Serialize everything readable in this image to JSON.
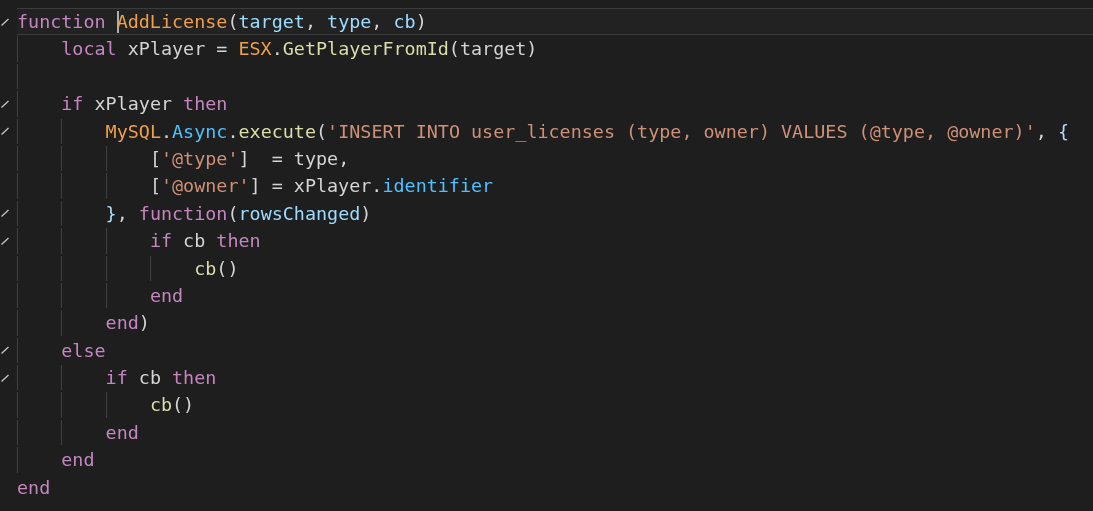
{
  "editor": {
    "lines": [
      {
        "foldable": true,
        "current": true,
        "tokens": [
          {
            "kind": "keyword",
            "text": "function "
          },
          {
            "kind": "funcdef",
            "text": "AddLicense",
            "cursor": true
          },
          {
            "kind": "plain",
            "text": "("
          },
          {
            "kind": "param",
            "text": "target"
          },
          {
            "kind": "plain",
            "text": ", "
          },
          {
            "kind": "param",
            "text": "type"
          },
          {
            "kind": "plain",
            "text": ", "
          },
          {
            "kind": "param",
            "text": "cb"
          },
          {
            "kind": "plain",
            "text": ")"
          }
        ]
      },
      {
        "foldable": false,
        "current": false,
        "tokens": [
          {
            "kind": "keyword",
            "text": "    local "
          },
          {
            "kind": "plain",
            "text": "xPlayer = "
          },
          {
            "kind": "global",
            "text": "ESX"
          },
          {
            "kind": "plain",
            "text": "."
          },
          {
            "kind": "call",
            "text": "GetPlayerFromId"
          },
          {
            "kind": "plain",
            "text": "(target)"
          }
        ]
      },
      {
        "foldable": false,
        "current": false
      },
      {
        "foldable": true,
        "current": false,
        "tokens": [
          {
            "kind": "keyword",
            "text": "    if "
          },
          {
            "kind": "plain",
            "text": "xPlayer "
          },
          {
            "kind": "keyword",
            "text": "then"
          }
        ]
      },
      {
        "foldable": true,
        "current": false,
        "tokens": [
          {
            "kind": "global",
            "text": "        MySQL"
          },
          {
            "kind": "plain",
            "text": "."
          },
          {
            "kind": "field",
            "text": "Async"
          },
          {
            "kind": "plain",
            "text": "."
          },
          {
            "kind": "call",
            "text": "execute"
          },
          {
            "kind": "plain",
            "text": "("
          },
          {
            "kind": "string",
            "text": "'INSERT INTO user_licenses (type, owner) VALUES (@type, @owner)'"
          },
          {
            "kind": "plain",
            "text": ", "
          },
          {
            "kind": "brace",
            "text": "{"
          }
        ]
      },
      {
        "foldable": false,
        "current": false,
        "tokens": [
          {
            "kind": "plain",
            "text": "            ["
          },
          {
            "kind": "string",
            "text": "'@type'"
          },
          {
            "kind": "plain",
            "text": "]  = type,"
          }
        ]
      },
      {
        "foldable": false,
        "current": false,
        "tokens": [
          {
            "kind": "plain",
            "text": "            ["
          },
          {
            "kind": "string",
            "text": "'@owner'"
          },
          {
            "kind": "plain",
            "text": "] = xPlayer."
          },
          {
            "kind": "field",
            "text": "identifier"
          }
        ]
      },
      {
        "foldable": true,
        "current": false,
        "tokens": [
          {
            "kind": "brace",
            "text": "        }"
          },
          {
            "kind": "plain",
            "text": ", "
          },
          {
            "kind": "keyword",
            "text": "function"
          },
          {
            "kind": "plain",
            "text": "("
          },
          {
            "kind": "param",
            "text": "rowsChanged"
          },
          {
            "kind": "plain",
            "text": ")"
          }
        ]
      },
      {
        "foldable": true,
        "current": false,
        "tokens": [
          {
            "kind": "keyword",
            "text": "            if "
          },
          {
            "kind": "plain",
            "text": "cb "
          },
          {
            "kind": "keyword",
            "text": "then"
          }
        ]
      },
      {
        "foldable": false,
        "current": false,
        "tokens": [
          {
            "kind": "call",
            "text": "                cb"
          },
          {
            "kind": "plain",
            "text": "()"
          }
        ]
      },
      {
        "foldable": false,
        "current": false,
        "tokens": [
          {
            "kind": "keyword",
            "text": "            end"
          }
        ]
      },
      {
        "foldable": false,
        "current": false,
        "tokens": [
          {
            "kind": "keyword",
            "text": "        end"
          },
          {
            "kind": "plain",
            "text": ")"
          }
        ]
      },
      {
        "foldable": true,
        "current": false,
        "tokens": [
          {
            "kind": "keyword",
            "text": "    else"
          }
        ]
      },
      {
        "foldable": true,
        "current": false,
        "tokens": [
          {
            "kind": "keyword",
            "text": "        if "
          },
          {
            "kind": "plain",
            "text": "cb "
          },
          {
            "kind": "keyword",
            "text": "then"
          }
        ]
      },
      {
        "foldable": false,
        "current": false,
        "tokens": [
          {
            "kind": "call",
            "text": "            cb"
          },
          {
            "kind": "plain",
            "text": "()"
          }
        ]
      },
      {
        "foldable": false,
        "current": false,
        "tokens": [
          {
            "kind": "keyword",
            "text": "        end"
          }
        ]
      },
      {
        "foldable": false,
        "current": false,
        "tokens": [
          {
            "kind": "keyword",
            "text": "    end"
          }
        ]
      },
      {
        "foldable": false,
        "current": false,
        "tokens": [
          {
            "kind": "keyword",
            "text": "end"
          }
        ]
      }
    ]
  }
}
